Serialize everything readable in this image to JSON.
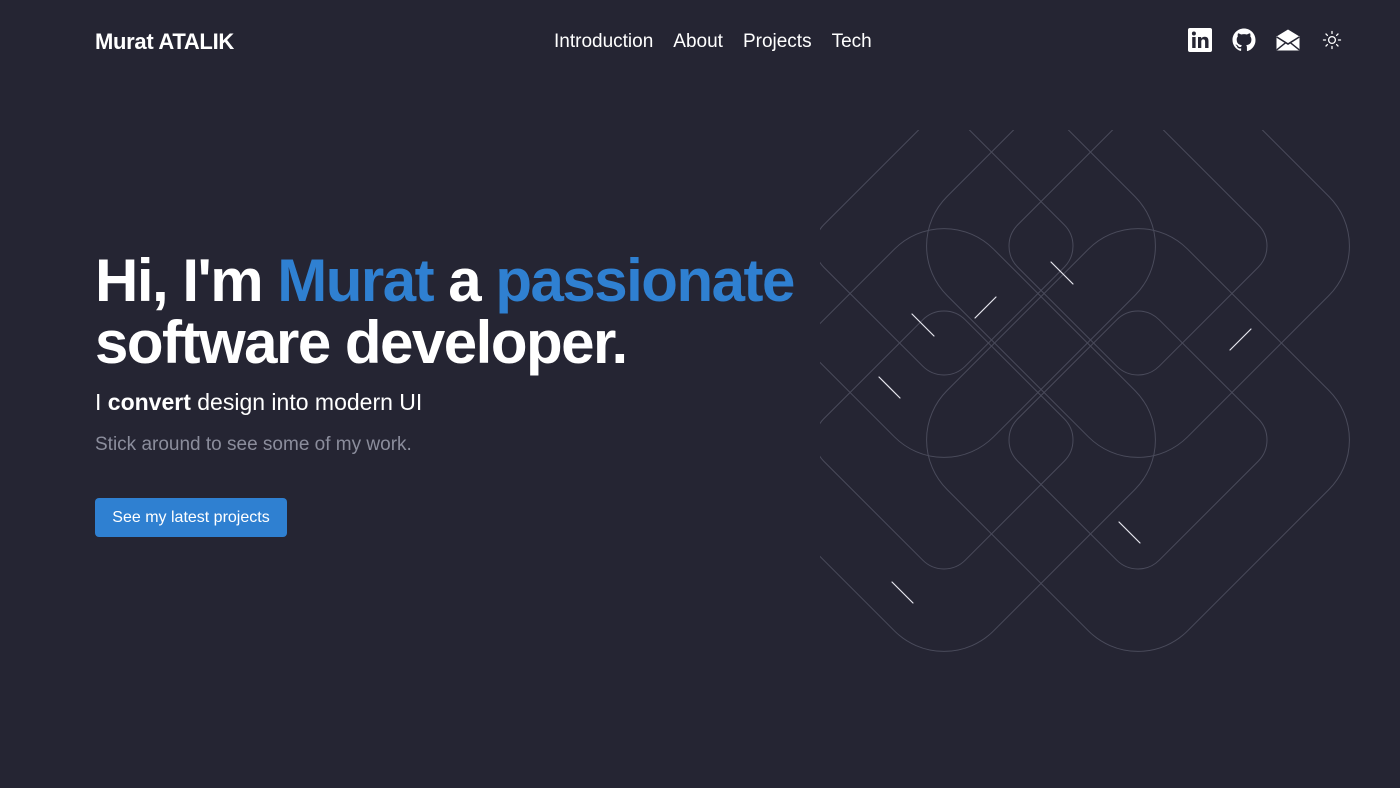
{
  "colors": {
    "background": "#252533",
    "accent": "#2f80d1",
    "muted": "#8b8d9c"
  },
  "header": {
    "brand": "Murat ATALIK",
    "menu": [
      {
        "label": "Introduction"
      },
      {
        "label": "About"
      },
      {
        "label": "Projects"
      },
      {
        "label": "Tech"
      }
    ],
    "social": [
      {
        "icon": "linkedin-icon"
      },
      {
        "icon": "github-icon"
      },
      {
        "icon": "mail-icon"
      },
      {
        "icon": "sun-icon"
      }
    ]
  },
  "hero": {
    "headline": {
      "prefix": "Hi, I'm ",
      "name": "Murat",
      "middle": " a ",
      "highlight": "passionate",
      "rest": "software developer."
    },
    "subline": {
      "start": "I ",
      "bold": "convert",
      "end": " design into modern UI"
    },
    "muted": "Stick around to see some of my work.",
    "cta": "See my latest projects"
  }
}
